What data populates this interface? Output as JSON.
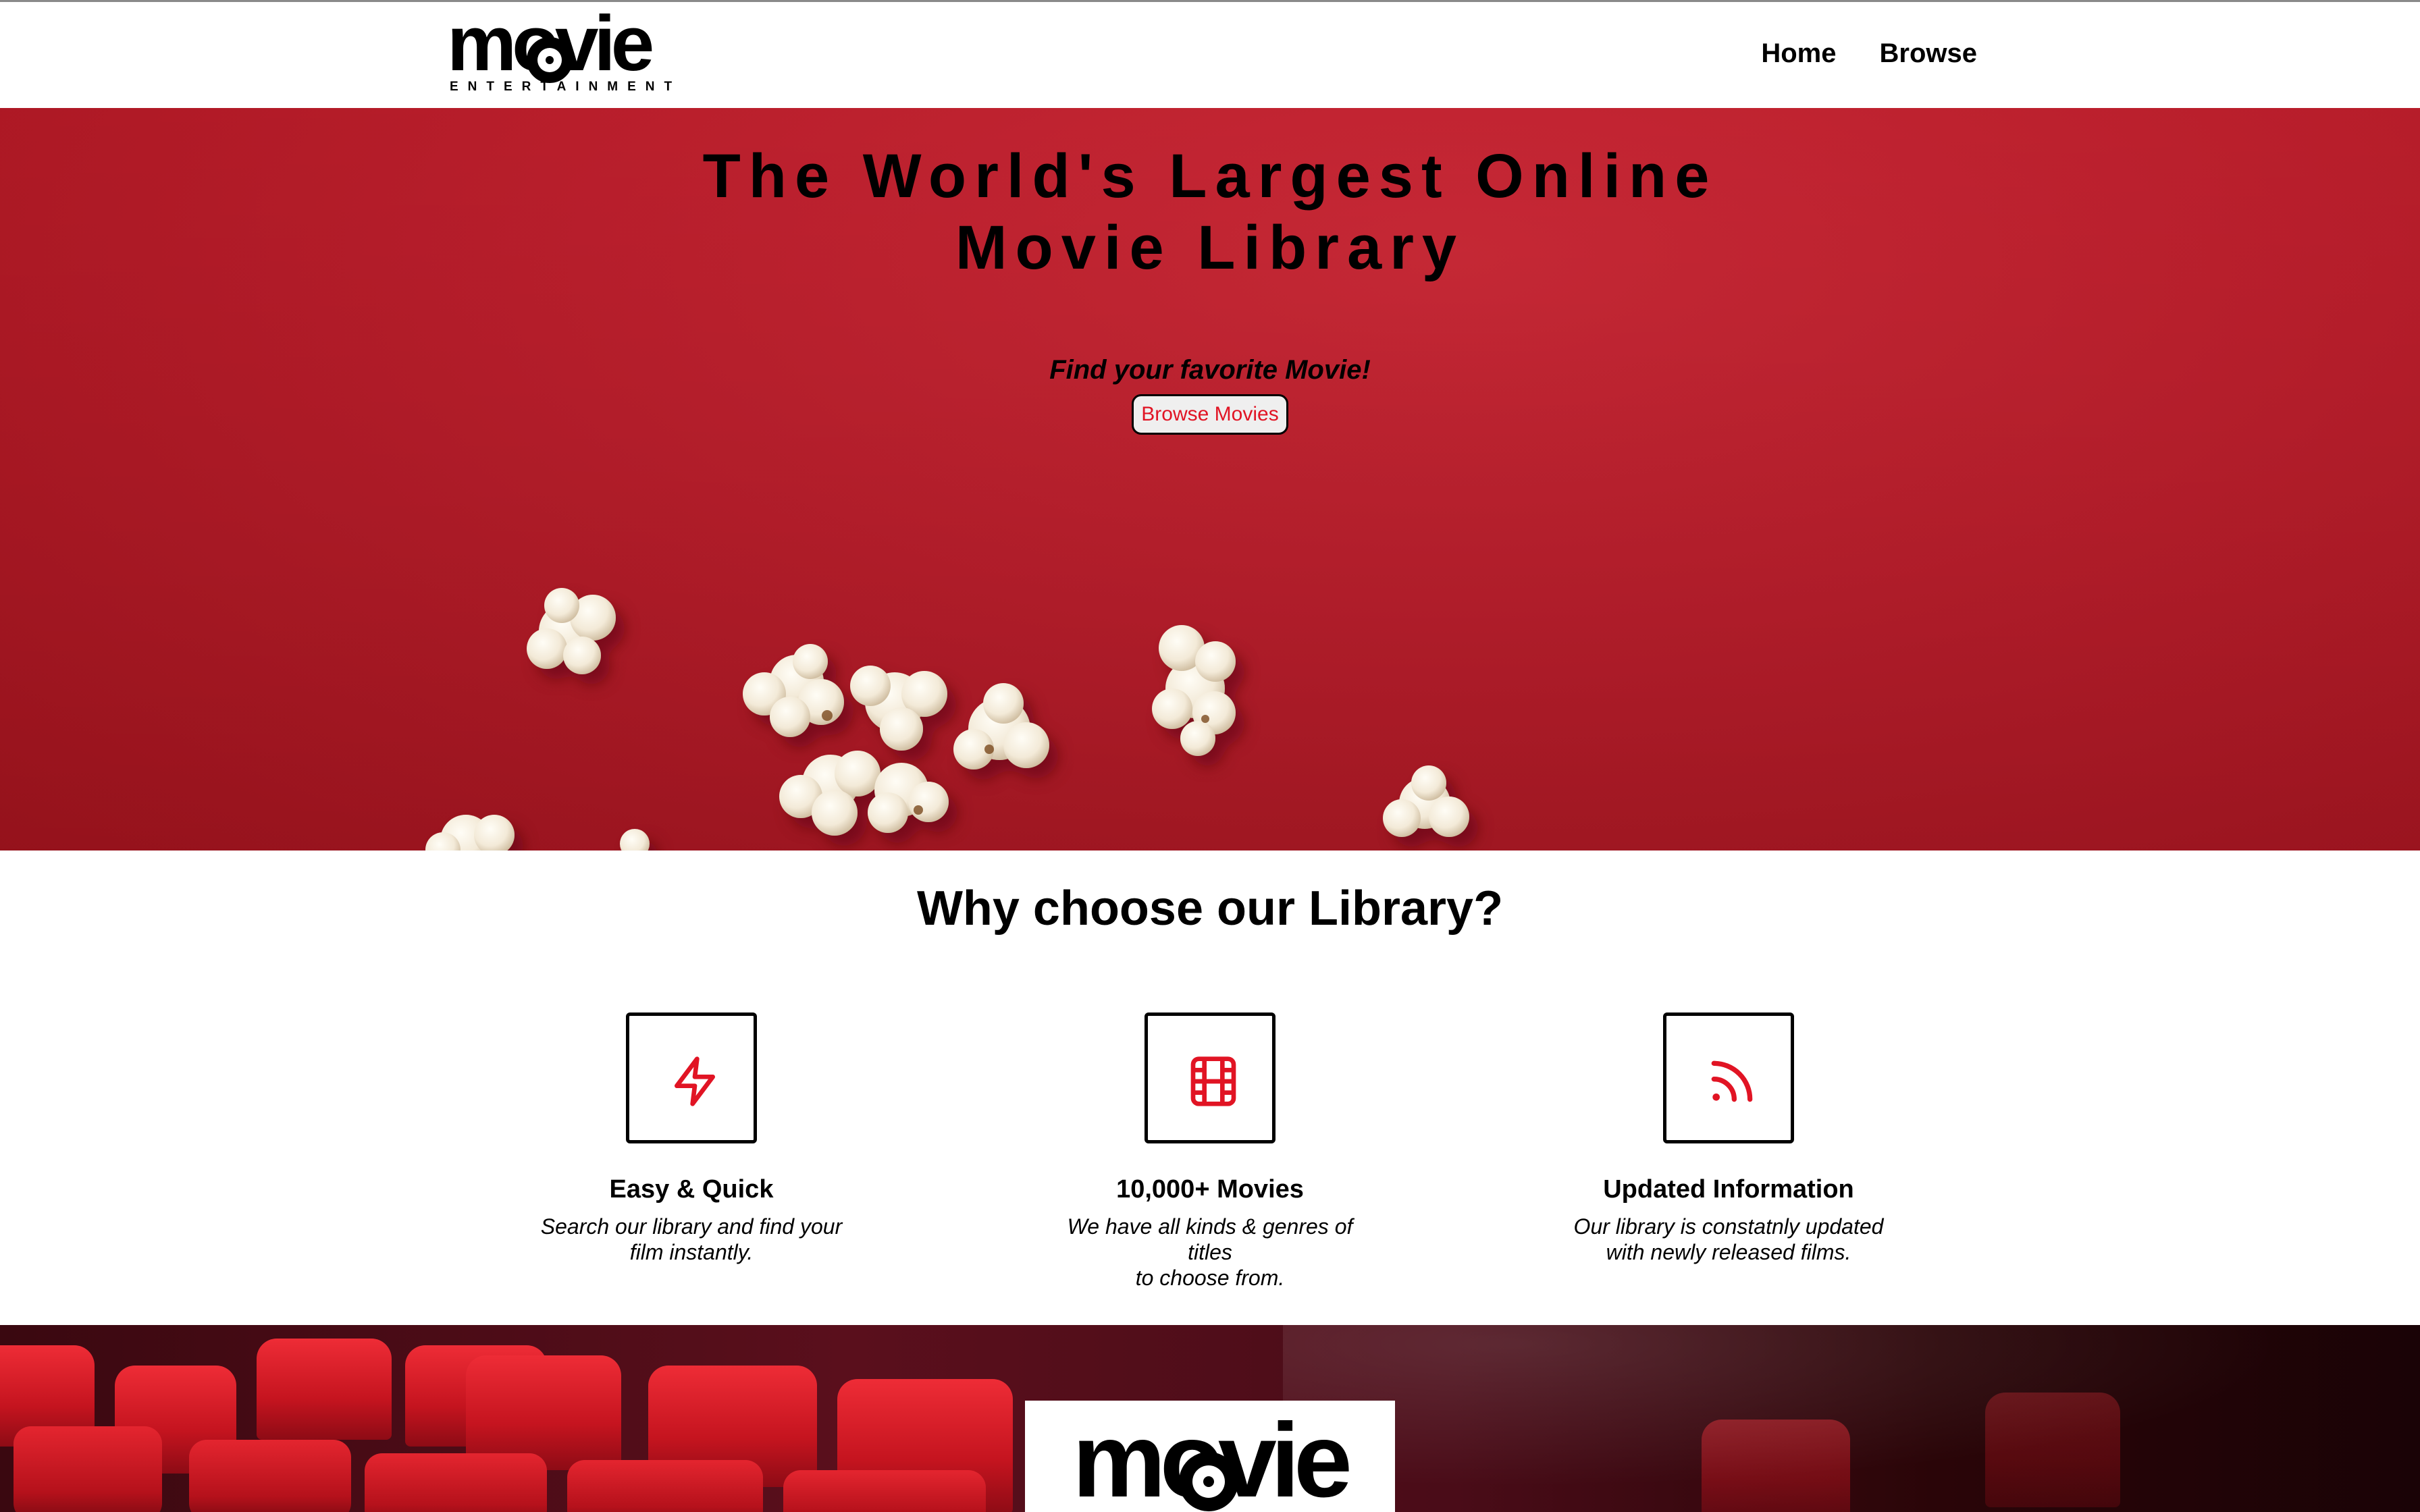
{
  "brand": {
    "logo_word": "movie",
    "logo_tagline": "ENTERTAINMENT"
  },
  "nav": {
    "items": [
      {
        "label": "Home"
      },
      {
        "label": "Browse"
      }
    ]
  },
  "hero": {
    "title_line1": "The World's Largest Online",
    "title_line2": "Movie Library",
    "tagline": "Find your favorite Movie!",
    "button_label": "Browse Movies"
  },
  "features": {
    "title": "Why choose our Library?",
    "items": [
      {
        "icon": "lightning-icon",
        "title": "Easy & Quick",
        "desc_line1": "Search our library and find your",
        "desc_line2": "film instantly."
      },
      {
        "icon": "film-icon",
        "title": "10,000+ Movies",
        "desc_line1": "We have all kinds & genres of titles",
        "desc_line2": "to choose from."
      },
      {
        "icon": "rss-icon",
        "title": "Updated Information",
        "desc_line1": "Our library is constatnly updated",
        "desc_line2": "with newly released films."
      }
    ]
  },
  "colors": {
    "accent_red": "#e11424",
    "hero_red": "#c01f2d",
    "text": "#000000",
    "background": "#ffffff"
  }
}
